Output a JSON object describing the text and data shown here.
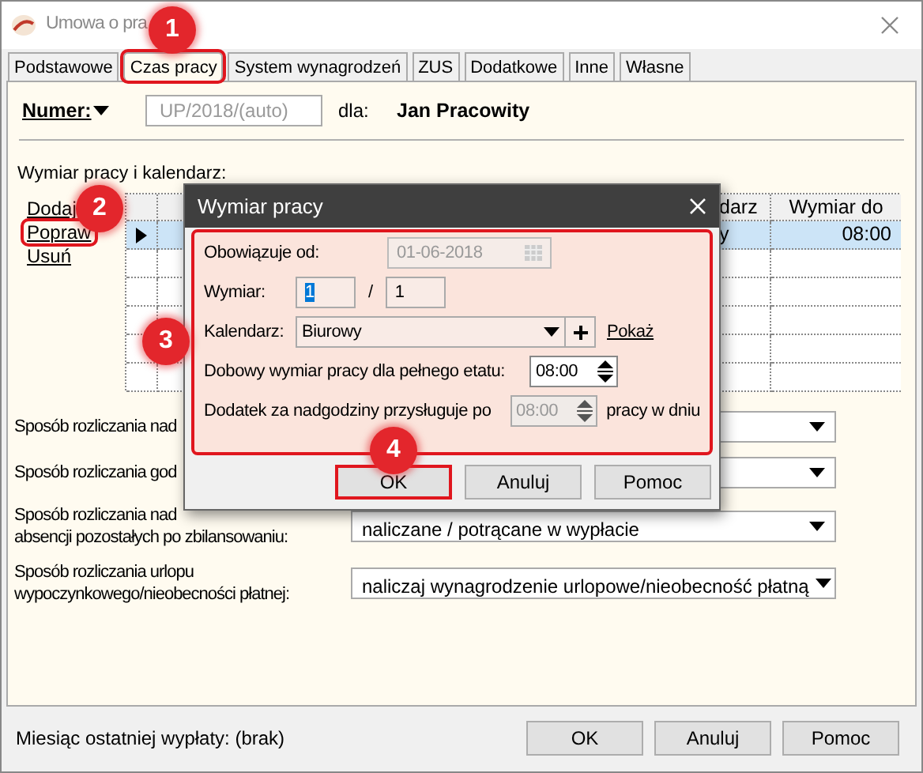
{
  "window": {
    "title": "Umowa o pra"
  },
  "tabs": [
    {
      "label": "Podstawowe",
      "selected": false,
      "highlighted": false
    },
    {
      "label": "Czas pracy",
      "selected": true,
      "highlighted": true
    },
    {
      "label": "System wynagrodzeń",
      "selected": false,
      "highlighted": false
    },
    {
      "label": "ZUS",
      "selected": false,
      "highlighted": false
    },
    {
      "label": "Dodatkowe",
      "selected": false,
      "highlighted": false
    },
    {
      "label": "Inne",
      "selected": false,
      "highlighted": false
    },
    {
      "label": "Własne",
      "selected": false,
      "highlighted": false
    }
  ],
  "header": {
    "number_label": "Numer:",
    "number_value": "UP/2018/(auto)",
    "for_label": "dla:",
    "employee": "Jan Pracowity"
  },
  "section_title": "Wymiar pracy i kalendarz:",
  "actions": [
    {
      "label": "Dodaj",
      "highlighted": false
    },
    {
      "label": "Popraw",
      "highlighted": true
    },
    {
      "label": "Usuń",
      "highlighted": false
    }
  ],
  "table": {
    "columns": [
      {
        "label": "darz"
      },
      {
        "label": "Wymiar do"
      }
    ],
    "rows": [
      {
        "selected": true,
        "cells": [
          "y",
          "08:00"
        ]
      }
    ]
  },
  "settings": [
    {
      "label_lines": [
        "Sposób rozliczania nad"
      ]
    },
    {
      "label_lines": [
        "Sposób rozliczania god"
      ]
    },
    {
      "label_lines": [
        "Sposób rozliczania nad",
        "absencji pozostałych po zbilansowaniu:"
      ],
      "value": "naliczane / potrącane w wypłacie"
    },
    {
      "label_lines": [
        "Sposób rozliczania urlopu",
        "wypoczynkowego/nieobecności płatnej:"
      ],
      "value": "naliczaj wynagrodzenie urlopowe/nieobecność płatną"
    }
  ],
  "dialog": {
    "title": "Wymiar pracy",
    "highlighted": true,
    "valid_from": {
      "label": "Obowiązuje od:",
      "value": "01-06-2018",
      "disabled": true
    },
    "fraction": {
      "label": "Wymiar:",
      "numerator": "1",
      "separator": "/",
      "denominator": "1"
    },
    "calendar": {
      "label": "Kalendarz:",
      "value": "Biurowy",
      "link": "Pokaż"
    },
    "daily": {
      "label": "Dobowy wymiar pracy dla pełnego etatu:",
      "value": "08:00",
      "disabled": false
    },
    "overtime": {
      "label": "Dodatek za nadgodziny przysługuje po",
      "value": "08:00",
      "disabled": true,
      "suffix": "pracy w dniu"
    },
    "buttons": [
      {
        "label": "OK",
        "highlighted": true
      },
      {
        "label": "Anuluj",
        "highlighted": false
      },
      {
        "label": "Pomoc",
        "highlighted": false
      }
    ]
  },
  "footer": {
    "last_payment": "Miesiąc ostatniej wypłaty: (brak)",
    "buttons": [
      "OK",
      "Anuluj",
      "Pomoc"
    ]
  },
  "annotations": [
    {
      "label": "1"
    },
    {
      "label": "2"
    },
    {
      "label": "3"
    },
    {
      "label": "4"
    }
  ]
}
